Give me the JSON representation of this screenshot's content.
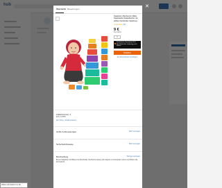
{
  "background": {
    "logo": "hub",
    "status_bar": "Warte auf tracker.xxx.de"
  },
  "modal": {
    "tabs": [
      {
        "label": "Übersicht"
      },
      {
        "label": "Bewertungen"
      }
    ],
    "product": {
      "title": "Stapelturm Becherturm Baby Stapelwürfel Stapelbecher mit Zahlen Kleinkinder Spielzeug",
      "rating": "★★★★★",
      "rating_count": "(12)",
      "price": "9 €",
      "price_note": "inkl. MwSt.",
      "quantity": "1",
      "promo_text": "Kostenloser Versand ab 29 € Bestellwert bei Lieferung nach Hause",
      "cart_button": "Kaufen",
      "wishlist": "Zur Wunschliste hinzufügen"
    },
    "article": {
      "label": "Artikelnummer: 1",
      "line2": "EAN: 123456",
      "line3": "Zum Shop · Details ansehen"
    },
    "sections": [
      {
        "label": "Größe & Abmessungen",
        "link": "Mehr anzeigen"
      },
      {
        "label": "Sicherheitshinweise",
        "link": "Mehr anzeigen"
      },
      {
        "label": "Beschreibung",
        "link": "Weniger anzeigen"
      }
    ],
    "description": "Bunter Stapelturm für Babys und Kleinkinder. Die Becher lassen sich stapeln und ineinander setzen und fördern die Feinmotorik."
  },
  "colors": {
    "cart": "#e8630a",
    "promo_bg": "#111111",
    "link": "#3d7ab8",
    "stars": "#f1a800"
  },
  "icons": {
    "close": "close-icon",
    "badge": "orange-dot-icon"
  }
}
